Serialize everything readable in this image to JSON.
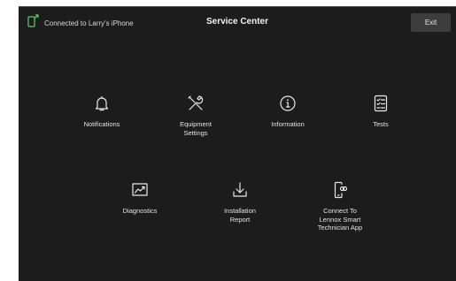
{
  "header": {
    "connection_text": "Connected to Larry's iPhone",
    "title": "Service Center",
    "exit_label": "Exit"
  },
  "menu": {
    "notifications": {
      "label": "Notifications",
      "icon": "bell-icon"
    },
    "equipment_settings": {
      "label": "Equipment\nSettings",
      "icon": "tools-icon"
    },
    "information": {
      "label": "Information",
      "icon": "info-icon"
    },
    "tests": {
      "label": "Tests",
      "icon": "checklist-icon"
    },
    "diagnostics": {
      "label": "Diagnostics",
      "icon": "chart-icon"
    },
    "installation_report": {
      "label": "Installation\nReport",
      "icon": "download-icon"
    },
    "connect_app": {
      "label": "Connect To\nLennox Smart\nTechnician App",
      "icon": "phone-link-icon"
    }
  },
  "colors": {
    "background": "#1c1c1c",
    "accent": "#5ad363",
    "text": "#e8e8e8",
    "button": "#3d3d3d"
  }
}
